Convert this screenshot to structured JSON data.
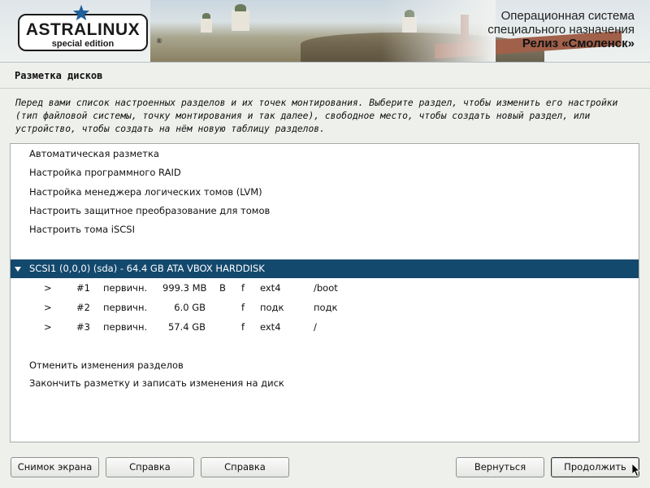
{
  "header": {
    "logo_text": "ASTRALINUX",
    "logo_sub": "special edition",
    "os_line1": "Операционная система",
    "os_line2": "специального назначения",
    "release": "Релиз «Смоленск»"
  },
  "page": {
    "title": "Разметка дисков",
    "description": "Перед вами список настроенных разделов и их точек монтирования. Выберите раздел, чтобы изменить его настройки (тип файловой системы, точку монтирования и так далее), свободное место, чтобы создать новый раздел, или устройство, чтобы создать на нём новую таблицу разделов."
  },
  "menu": {
    "top_items": [
      "Автоматическая разметка",
      "Настройка программного RAID",
      "Настройка менеджера логических томов (LVM)",
      "Настроить защитное преобразование для томов",
      "Настроить тома iSCSI"
    ],
    "disk": {
      "label": "SCSI1 (0,0,0) (sda) - 64.4 GB ATA VBOX HARDDISK",
      "selected": true
    },
    "partitions": [
      {
        "arrow": ">",
        "num": "#1",
        "type": "первичн.",
        "size": "999.3 MB",
        "boot": "B",
        "flag": "f",
        "fs": "ext4",
        "mount": "/boot"
      },
      {
        "arrow": ">",
        "num": "#2",
        "type": "первичн.",
        "size": "6.0 GB",
        "boot": "",
        "flag": "f",
        "fs": "подк",
        "mount": "подк"
      },
      {
        "arrow": ">",
        "num": "#3",
        "type": "первичн.",
        "size": "57.4 GB",
        "boot": "",
        "flag": "f",
        "fs": "ext4",
        "mount": "/"
      }
    ],
    "bottom_items": [
      "Отменить изменения разделов",
      "Закончить разметку и записать изменения на диск"
    ]
  },
  "buttons": {
    "screenshot": "Снимок экрана",
    "help1": "Справка",
    "help2": "Справка",
    "back": "Вернуться",
    "continue": "Продолжить"
  },
  "colors": {
    "selection": "#14496e",
    "background": "#eef0ec"
  }
}
